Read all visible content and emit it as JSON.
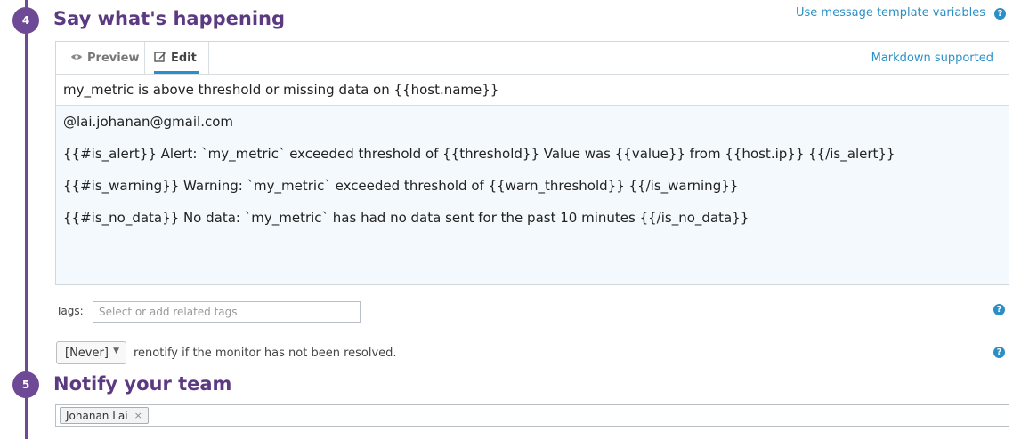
{
  "colors": {
    "accent": "#6e4a96",
    "link": "#2a8fc6",
    "editor_bg": "#f3f9fc"
  },
  "step4": {
    "number": "4",
    "title": "Say what's happening"
  },
  "template_link": {
    "label": "Use message template variables",
    "help_icon": "question-circle-icon"
  },
  "editor": {
    "tabs": [
      {
        "label": "Preview",
        "icon": "eye-icon",
        "active": false
      },
      {
        "label": "Edit",
        "icon": "edit-icon",
        "active": true
      }
    ],
    "markdown_link": "Markdown supported",
    "title_value": "my_metric is above threshold or missing data on {{host.name}}",
    "body_lines": [
      "@lai.johanan@gmail.com",
      "{{#is_alert}} Alert:  `my_metric` exceeded threshold of {{threshold}}  Value was {{value}} from {{host.ip}} {{/is_alert}}",
      "{{#is_warning}} Warning:  `my_metric` exceeded threshold of {{warn_threshold}}  {{/is_warning}}",
      "{{#is_no_data}} No data:  `my_metric` has had no data sent for the past 10 minutes {{/is_no_data}}"
    ]
  },
  "tags": {
    "label": "Tags:",
    "placeholder": "Select or add related tags"
  },
  "renotify": {
    "selected": "[Never]",
    "text": "renotify if the monitor has not been resolved."
  },
  "step5": {
    "number": "5",
    "title": "Notify your team"
  },
  "team": {
    "recipients": [
      "Johanan Lai"
    ]
  }
}
